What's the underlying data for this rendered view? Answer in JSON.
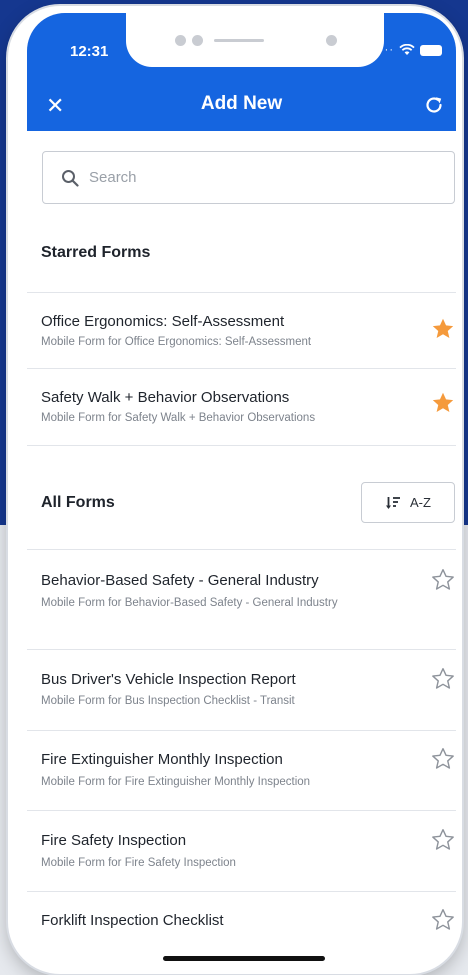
{
  "status": {
    "time": "12:31"
  },
  "header": {
    "title": "Add New",
    "close_symbol": "✕"
  },
  "search": {
    "placeholder": "Search",
    "value": ""
  },
  "starred": {
    "heading": "Starred Forms",
    "items": [
      {
        "title": "Office Ergonomics: Self-Assessment",
        "subtitle": "Mobile Form for Office Ergonomics: Self-Assessment",
        "starred": true
      },
      {
        "title": "Safety Walk + Behavior Observations",
        "subtitle": "Mobile Form for Safety Walk + Behavior Observations",
        "starred": true
      }
    ]
  },
  "all_forms": {
    "heading": "All Forms",
    "sort_label": "A-Z",
    "items": [
      {
        "title": "Behavior-Based Safety - General Industry",
        "subtitle": "Mobile Form for Behavior-Based Safety - General Industry",
        "starred": false
      },
      {
        "title": "Bus Driver's Vehicle Inspection Report",
        "subtitle": "Mobile Form for Bus Inspection Checklist - Transit",
        "starred": false
      },
      {
        "title": "Fire Extinguisher Monthly Inspection",
        "subtitle": "Mobile Form for Fire Extinguisher Monthly Inspection",
        "starred": false
      },
      {
        "title": "Fire Safety Inspection",
        "subtitle": "Mobile Form for Fire Safety Inspection",
        "starred": false
      },
      {
        "title": "Forklift Inspection Checklist",
        "subtitle": "",
        "starred": false
      }
    ]
  },
  "colors": {
    "appbar": "#1565e0",
    "star_filled": "#f59a3c",
    "star_outline": "#8e939b",
    "background_top": "#15378f"
  },
  "icons": [
    "close-icon",
    "refresh-icon",
    "search-icon",
    "star-filled-icon",
    "star-outline-icon",
    "sort-descending-icon",
    "wifi-icon",
    "battery-icon"
  ]
}
